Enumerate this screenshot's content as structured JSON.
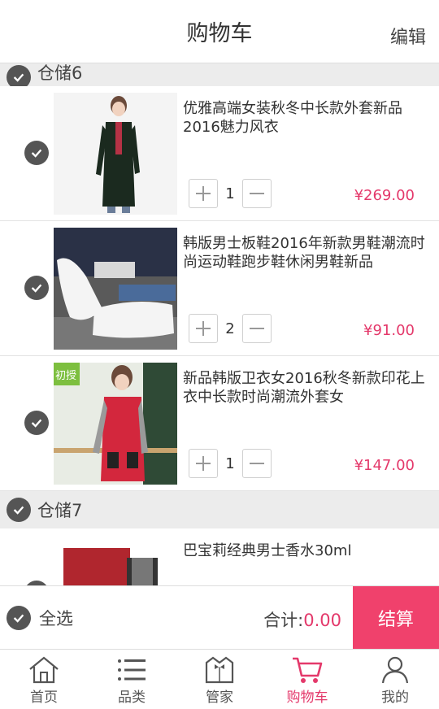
{
  "header": {
    "title": "购物车",
    "edit_label": "编辑"
  },
  "groups": [
    {
      "name": "仓储6",
      "items": [
        {
          "name": "优雅高端女装秋冬中长款外套新品2016魅力风衣",
          "qty": "1",
          "price": "¥269.00"
        },
        {
          "name": "韩版男士板鞋2016年新款男鞋潮流时尚运动鞋跑步鞋休闲男鞋新品",
          "qty": "2",
          "price": "¥91.00"
        },
        {
          "name": "新品韩版卫衣女2016秋冬新款印花上衣中长款时尚潮流外套女",
          "qty": "1",
          "price": "¥147.00",
          "badge": "初授"
        }
      ]
    },
    {
      "name": "仓储7",
      "items": [
        {
          "name": "巴宝莉经典男士香水30ml"
        }
      ]
    }
  ],
  "footer": {
    "select_all": "全选",
    "total_label": "合计:",
    "total_value": "0.00",
    "checkout": "结算"
  },
  "tabs": [
    {
      "label": "首页",
      "icon": "home-icon"
    },
    {
      "label": "品类",
      "icon": "list-icon"
    },
    {
      "label": "管家",
      "icon": "butler-icon"
    },
    {
      "label": "购物车",
      "icon": "cart-icon"
    },
    {
      "label": "我的",
      "icon": "user-icon"
    }
  ],
  "colors": {
    "accent": "#e4396b",
    "checkout_bg": "#f0416c"
  }
}
